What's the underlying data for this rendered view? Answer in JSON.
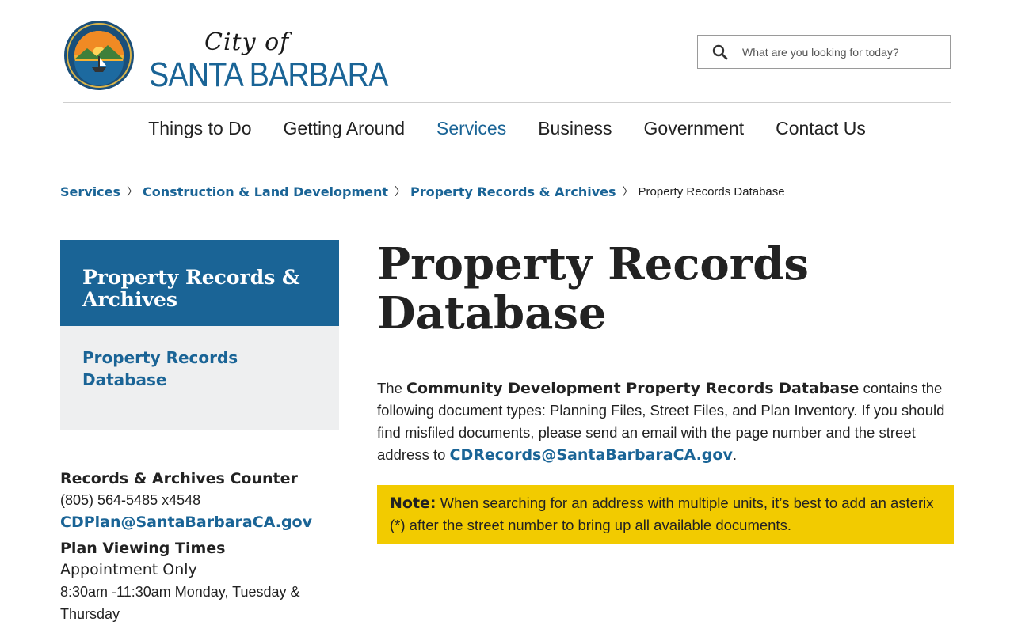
{
  "header": {
    "logo_city": "City of",
    "logo_name": "SANTA BARBARA",
    "search_placeholder": "What are you looking for today?"
  },
  "nav": {
    "items": [
      {
        "label": "Things to Do"
      },
      {
        "label": "Getting Around"
      },
      {
        "label": "Services"
      },
      {
        "label": "Business"
      },
      {
        "label": "Government"
      },
      {
        "label": "Contact Us"
      }
    ],
    "active": "Services"
  },
  "breadcrumb": {
    "items": [
      "Services",
      "Construction & Land Development",
      "Property Records & Archives"
    ],
    "separator": "〉",
    "current": "Property Records Database"
  },
  "sidebar": {
    "heading": "Property Records & Archives",
    "links": [
      "Property Records Database"
    ]
  },
  "contact": {
    "counter_title": "Records & Archives Counter",
    "phone": "(805) 564-5485 x4548",
    "email": "CDPlan@SantaBarbaraCA.gov",
    "times_title": "Plan Viewing Times",
    "appointment": "Appointment Only",
    "hours": "8:30am -11:30am Monday, Tuesday & Thursday"
  },
  "main": {
    "title": "Property Records Database",
    "intro_pre": "The ",
    "intro_strong": "Community Development Property Records Database",
    "intro_post": " contains the following document types: Planning Files, Street Files, and Plan Inventory.  If you should find misfiled documents, please send an email with the page number and the street address to ",
    "intro_email": "CDRecords@SantaBarbaraCA.gov",
    "intro_end": ".",
    "note_label": "Note:",
    "note_text": " When searching for an address with multiple units, it’s best to add an asterix (*) after the street number to bring up all available documents."
  },
  "colors": {
    "brand_blue": "#1a6496",
    "note_yellow": "#f2cb00",
    "sidebar_bg": "#eeeff0"
  }
}
